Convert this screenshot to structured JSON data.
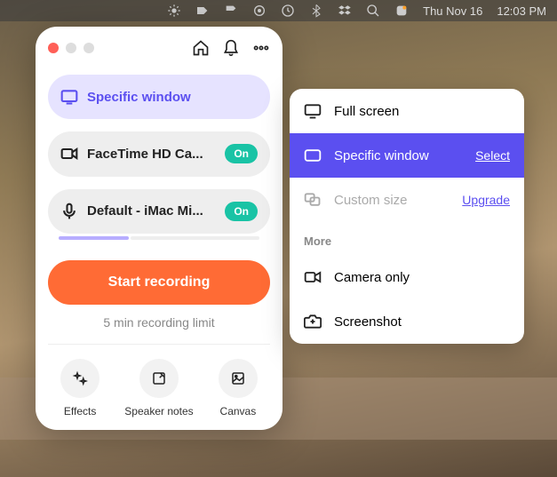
{
  "menubar": {
    "date": "Thu Nov 16",
    "time": "12:03 PM"
  },
  "main": {
    "source": {
      "label": "Specific window"
    },
    "camera": {
      "label": "FaceTime HD Ca...",
      "badge": "On"
    },
    "mic": {
      "label": "Default - iMac Mi...",
      "badge": "On"
    },
    "start_label": "Start recording",
    "limit_text": "5 min recording limit",
    "tools": {
      "effects": "Effects",
      "speaker_notes": "Speaker notes",
      "canvas": "Canvas"
    }
  },
  "popup": {
    "full_screen": "Full screen",
    "specific_window": "Specific window",
    "select": "Select",
    "custom_size": "Custom size",
    "upgrade": "Upgrade",
    "more": "More",
    "camera_only": "Camera only",
    "screenshot": "Screenshot"
  }
}
